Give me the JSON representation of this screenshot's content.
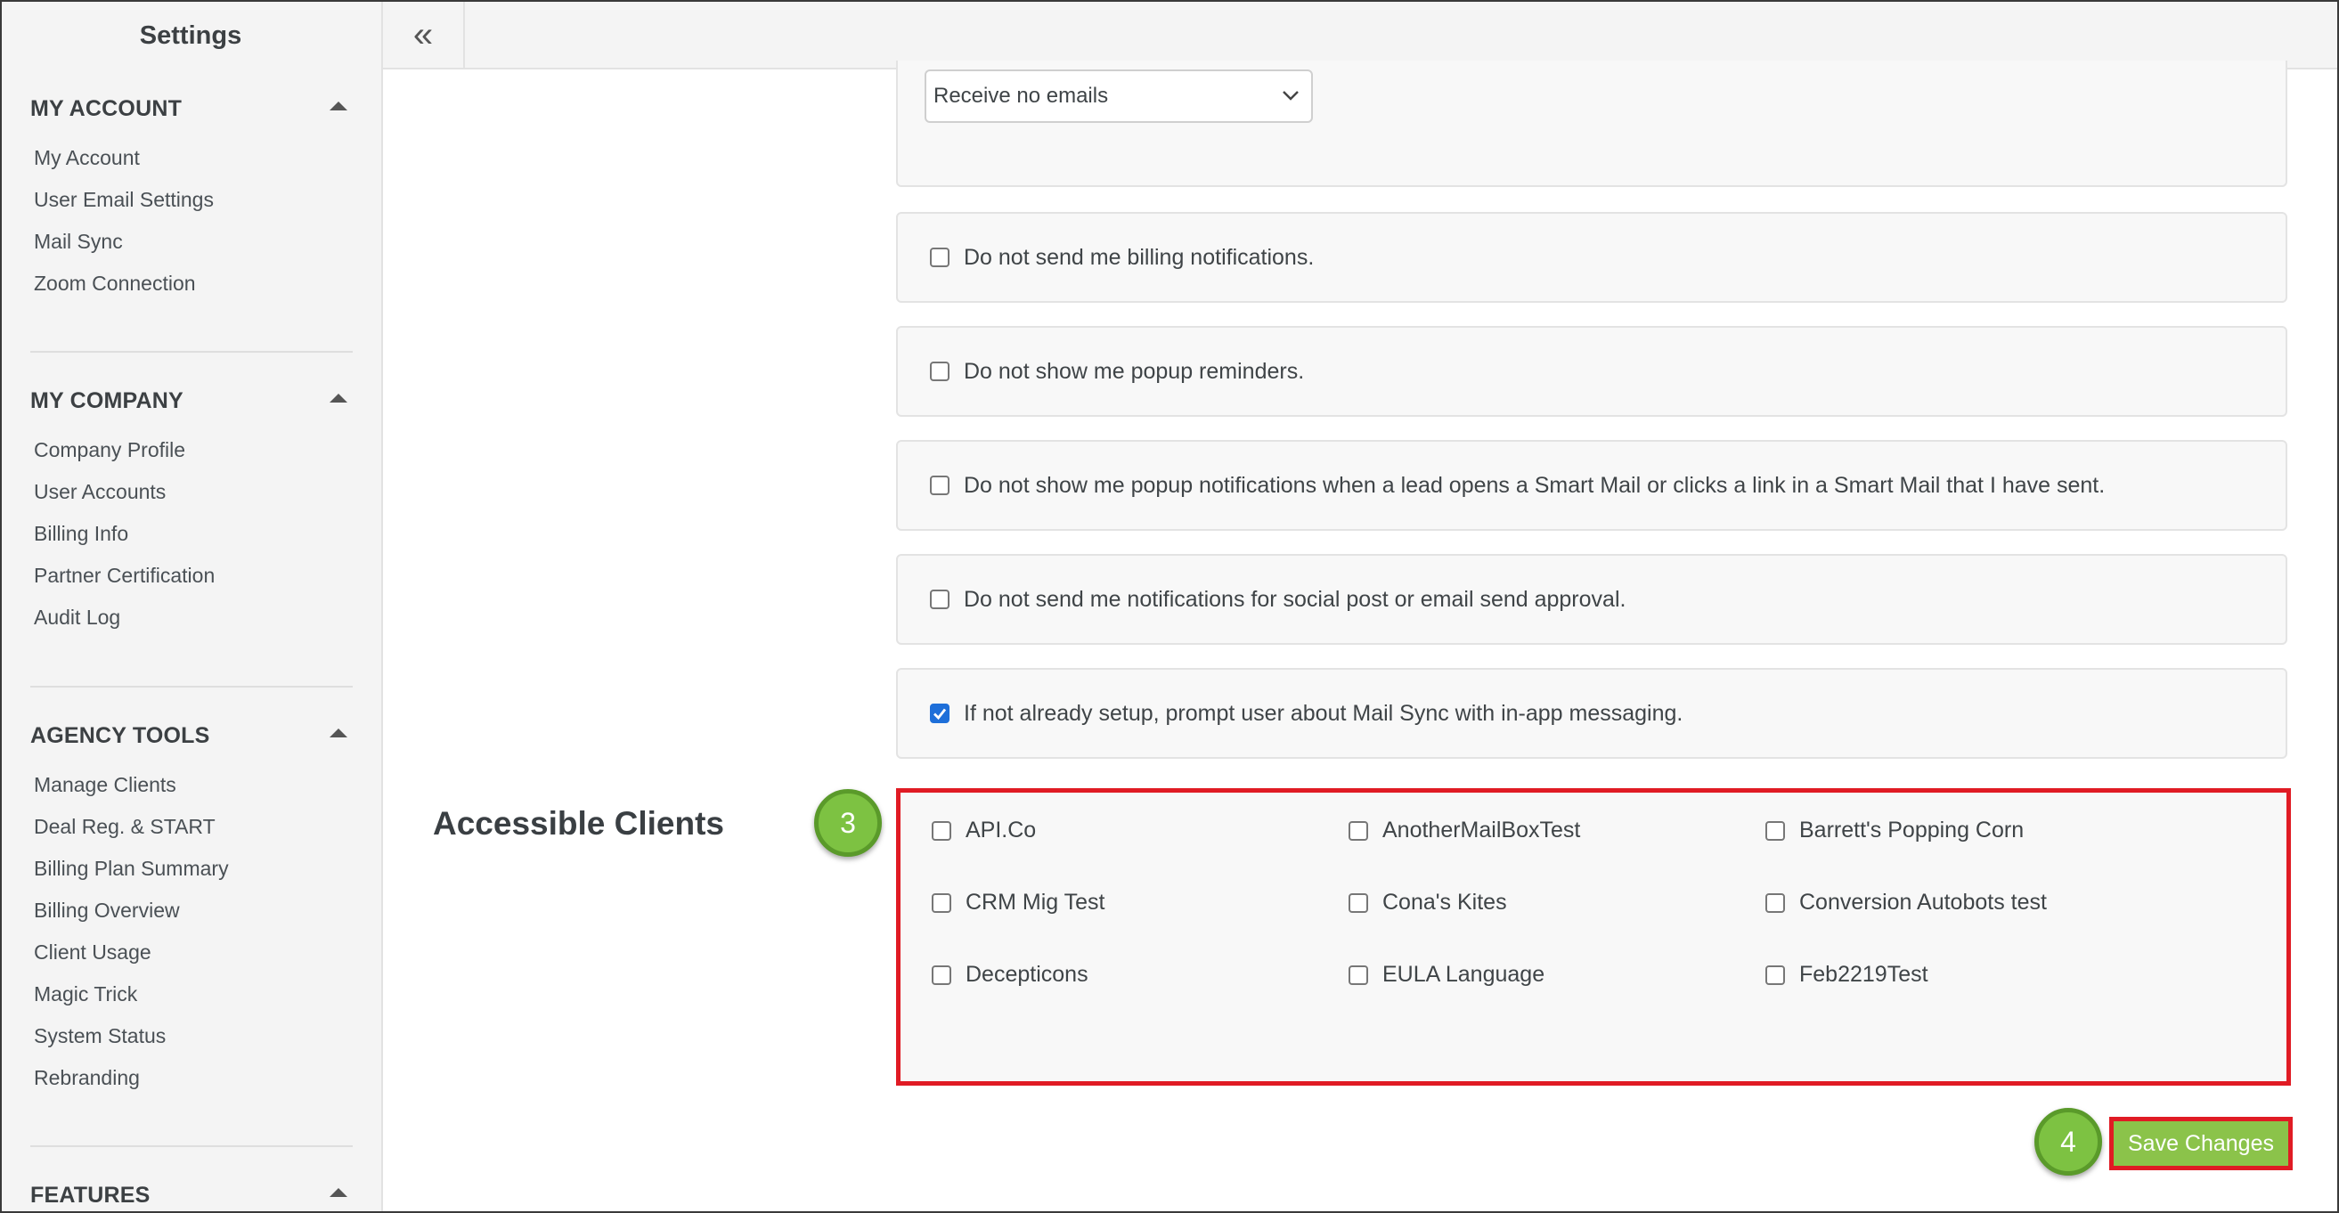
{
  "sidebar": {
    "title": "Settings",
    "sections": [
      {
        "label": "MY ACCOUNT",
        "items": [
          "My Account",
          "User Email Settings",
          "Mail Sync",
          "Zoom Connection"
        ]
      },
      {
        "label": "MY COMPANY",
        "items": [
          "Company Profile",
          "User Accounts",
          "Billing Info",
          "Partner Certification",
          "Audit Log"
        ]
      },
      {
        "label": "AGENCY TOOLS",
        "items": [
          "Manage Clients",
          "Deal Reg. & START",
          "Billing Plan Summary",
          "Billing Overview",
          "Client Usage",
          "Magic Trick",
          "System Status",
          "Rebranding"
        ]
      },
      {
        "label": "FEATURES",
        "items": []
      }
    ]
  },
  "topbar": {
    "collapse_icon": "double-chevron-left-icon",
    "collapse_glyph": "«"
  },
  "email_pref": {
    "selected": "Receive no emails"
  },
  "options": [
    {
      "label": "Do not send me billing notifications.",
      "checked": false
    },
    {
      "label": "Do not show me popup reminders.",
      "checked": false
    },
    {
      "label": "Do not show me popup notifications when a lead opens a Smart Mail or clicks a link in a Smart Mail that I have sent.",
      "checked": false
    },
    {
      "label": "Do not send me notifications for social post or email send approval.",
      "checked": false
    },
    {
      "label": "If not already setup, prompt user about Mail Sync with in-app messaging.",
      "checked": true
    }
  ],
  "accessible_clients": {
    "heading": "Accessible Clients",
    "clients": [
      {
        "label": "API.Co",
        "checked": false
      },
      {
        "label": "AnotherMailBoxTest",
        "checked": false
      },
      {
        "label": "Barrett's Popping Corn",
        "checked": false
      },
      {
        "label": "CRM Mig Test",
        "checked": false
      },
      {
        "label": "Cona's Kites",
        "checked": false
      },
      {
        "label": "Conversion Autobots test",
        "checked": false
      },
      {
        "label": "Decepticons",
        "checked": false
      },
      {
        "label": "EULA Language",
        "checked": false
      },
      {
        "label": "Feb2219Test",
        "checked": false
      }
    ]
  },
  "steps": {
    "clients_step": "3",
    "save_step": "4"
  },
  "save_label": "Save Changes",
  "colors": {
    "highlight": "#e01b24",
    "save_button": "#8bc34a",
    "step_badge": "#7dc242",
    "checkbox_checked": "#1e6fd9"
  }
}
